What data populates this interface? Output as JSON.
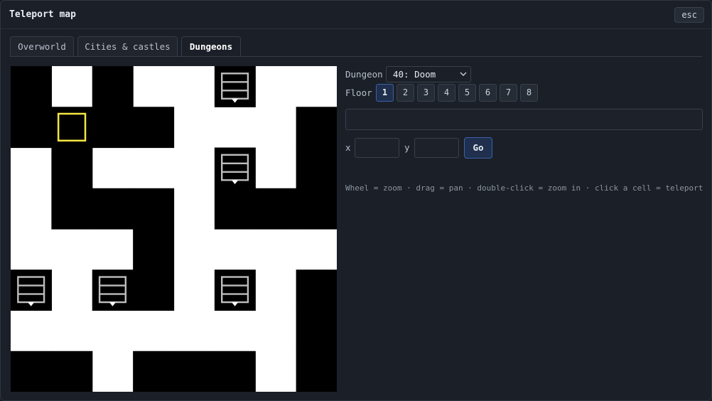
{
  "window": {
    "title": "Teleport map",
    "close_label": "esc"
  },
  "tabs": [
    {
      "label": "Overworld",
      "active": false
    },
    {
      "label": "Cities & castles",
      "active": false
    },
    {
      "label": "Dungeons",
      "active": true
    }
  ],
  "map": {
    "grid_cols": 8,
    "grid_rows": 8,
    "cell_colors": {
      "wall": "#000000",
      "floor": "#ffffff",
      "cursor": "#f5e642",
      "stairs": "#bdbdbd"
    },
    "wall_rows": [
      "10100100",
      "11110001",
      "01000101",
      "01110111",
      "00010000",
      "10110101",
      "00000001",
      "11011101"
    ],
    "stairs_cells": [
      [
        5,
        0
      ],
      [
        5,
        2
      ],
      [
        0,
        5
      ],
      [
        2,
        5
      ],
      [
        5,
        5
      ]
    ],
    "cursor_cell": [
      1,
      1
    ],
    "stairs_icon": "stairs-icon",
    "cursor_icon": "cursor-square-icon"
  },
  "controls": {
    "dungeon_label": "Dungeon",
    "dungeon_selected": "40: Doom",
    "floor_label": "Floor",
    "floors": [
      "1",
      "2",
      "3",
      "4",
      "5",
      "6",
      "7",
      "8"
    ],
    "active_floor": "1",
    "x_label": "x",
    "y_label": "y",
    "go_label": "Go",
    "hint": "Wheel = zoom · drag = pan · double-click = zoom in · click a cell = teleport"
  }
}
